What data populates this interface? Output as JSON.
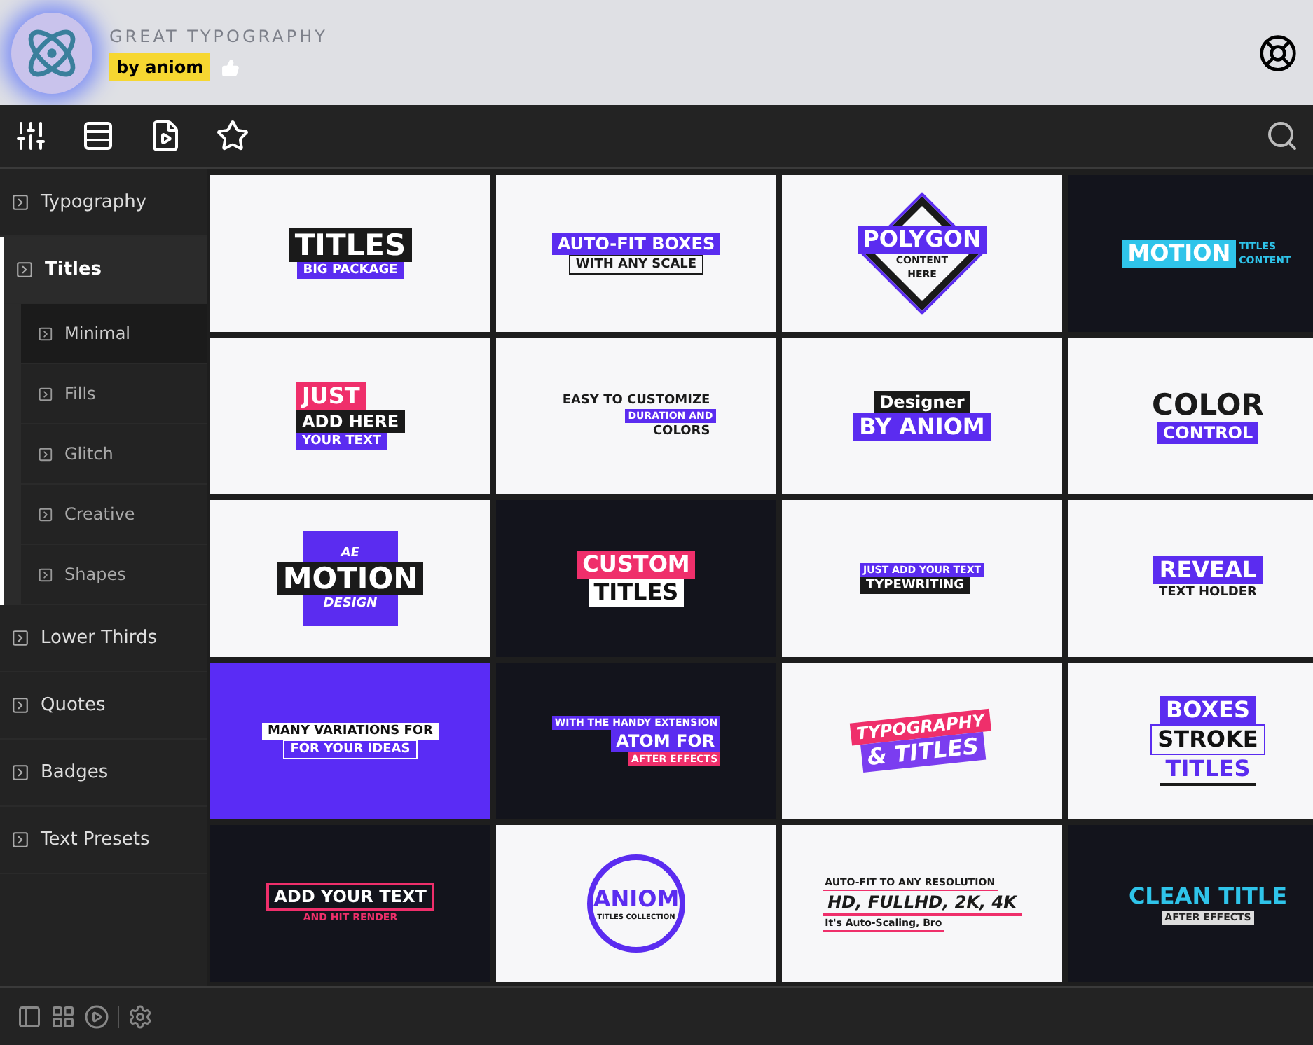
{
  "header": {
    "title": "GREAT TYPOGRAPHY",
    "author": "by aniom"
  },
  "sidebar": {
    "items": [
      {
        "label": "Typography",
        "selected": false,
        "expanded": false
      },
      {
        "label": "Titles",
        "selected": true,
        "expanded": true,
        "children": [
          {
            "label": "Minimal",
            "selected": true
          },
          {
            "label": "Fills",
            "selected": false
          },
          {
            "label": "Glitch",
            "selected": false
          },
          {
            "label": "Creative",
            "selected": false
          },
          {
            "label": "Shapes",
            "selected": false
          }
        ]
      },
      {
        "label": "Lower Thirds",
        "selected": false,
        "expanded": false
      },
      {
        "label": "Quotes",
        "selected": false,
        "expanded": false
      },
      {
        "label": "Badges",
        "selected": false,
        "expanded": false
      },
      {
        "label": "Text Presets",
        "selected": false,
        "expanded": false
      }
    ]
  },
  "thumbnails": [
    {
      "lines": [
        "TITLES",
        "BIG PACKAGE"
      ]
    },
    {
      "lines": [
        "AUTO-FIT BOXES",
        "WITH ANY SCALE"
      ]
    },
    {
      "lines": [
        "POLYGON",
        "CONTENT",
        "HERE"
      ]
    },
    {
      "lines": [
        "MOTION",
        "TITLES",
        "CONTENT"
      ]
    },
    {
      "lines": [
        "JUST",
        "ADD HERE",
        "YOUR TEXT"
      ]
    },
    {
      "lines": [
        "EASY TO CUSTOMIZE",
        "DURATION AND",
        "COLORS"
      ]
    },
    {
      "lines": [
        "Designer",
        "BY ANIOM"
      ]
    },
    {
      "lines": [
        "COLOR",
        "CONTROL"
      ]
    },
    {
      "lines": [
        "AE",
        "MOTION",
        "DESIGN"
      ]
    },
    {
      "lines": [
        "CUSTOM",
        "TITLES"
      ]
    },
    {
      "lines": [
        "JUST ADD YOUR TEXT",
        "TYPEWRITING"
      ]
    },
    {
      "lines": [
        "REVEAL",
        "TEXT HOLDER"
      ]
    },
    {
      "lines": [
        "MANY VARIATIONS FOR",
        "FOR YOUR IDEAS"
      ]
    },
    {
      "lines": [
        "WITH THE HANDY EXTENSION",
        "ATOM FOR",
        "AFTER EFFECTS"
      ]
    },
    {
      "lines": [
        "TYPOGRAPHY",
        "& TITLES"
      ]
    },
    {
      "lines": [
        "BOXES",
        "STROKE",
        "TITLES"
      ]
    },
    {
      "lines": [
        "ADD YOUR TEXT",
        "AND HIT RENDER"
      ]
    },
    {
      "lines": [
        "ANIOM",
        "TITLES COLLECTION"
      ]
    },
    {
      "lines": [
        "AUTO-FIT TO ANY RESOLUTION",
        "HD, FULLHD, 2K, 4K",
        "It's Auto-Scaling, Bro"
      ]
    },
    {
      "lines": [
        "CLEAN TITLE",
        "AFTER EFFECTS"
      ]
    }
  ]
}
